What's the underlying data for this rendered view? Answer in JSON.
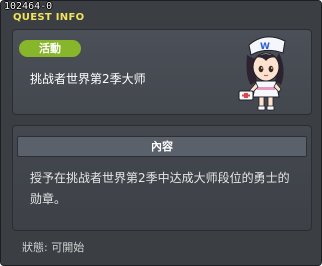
{
  "header": {
    "quest_id": "102464-0",
    "title": "QUEST INFO"
  },
  "quest": {
    "badge": "活動",
    "name": "挑战者世界第2季大师",
    "icon": "npc-nurse-icon"
  },
  "content": {
    "section_title": "內容",
    "description": "授予在挑战者世界第2季中达成大师段位的勇士的勋章。"
  },
  "footer": {
    "status": "狀態: 可開始"
  },
  "colors": {
    "title": "#f2e45a",
    "badge": "#87b62b",
    "background": "#3b3f44"
  }
}
